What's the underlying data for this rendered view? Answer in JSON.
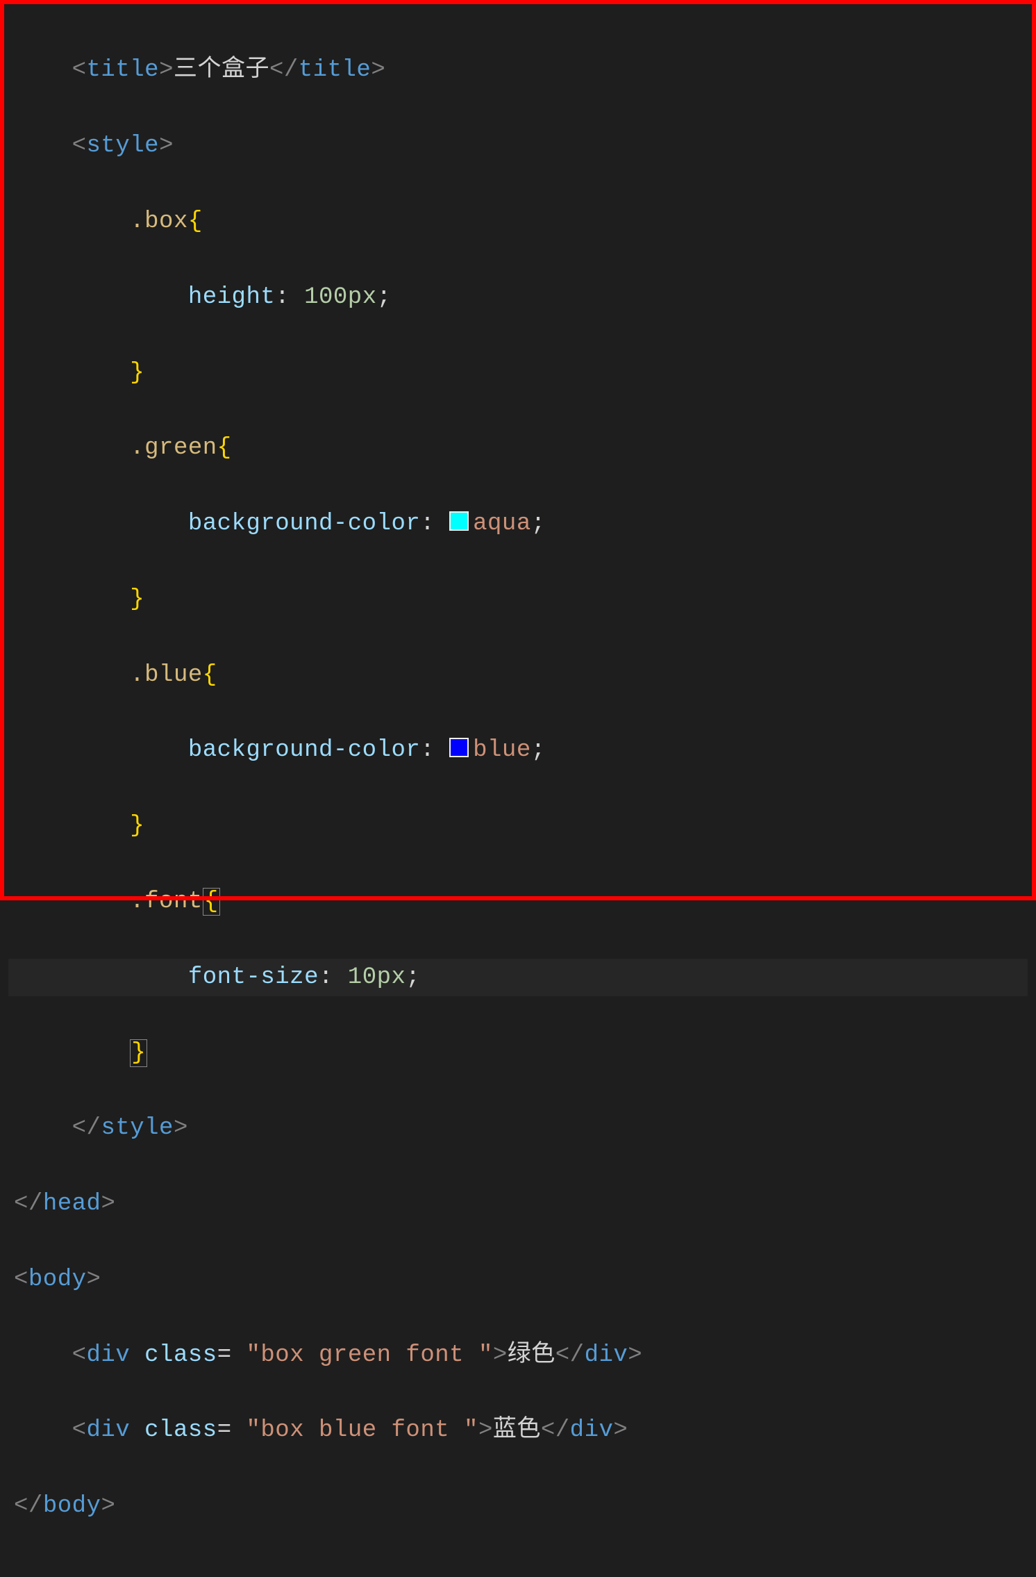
{
  "code": {
    "title_open_bracket1": "<",
    "title_tag": "title",
    "title_open_bracket2": ">",
    "title_text": "三个盒子",
    "title_close_bracket1": "</",
    "title_close_bracket2": ">",
    "style_open_bracket1": "<",
    "style_tag": "style",
    "style_open_bracket2": ">",
    "sel_box": ".box",
    "brace_open": "{",
    "brace_close": "}",
    "prop_height": "height",
    "colon": ":",
    "val_100px": "100px",
    "semicolon": ";",
    "sel_green": ".green",
    "prop_bg": "background-color",
    "val_aqua": "aqua",
    "sel_blue": ".blue",
    "val_blue": "blue",
    "sel_font": ".font",
    "prop_fontsize": "font-size",
    "val_10px": "10px",
    "style_close_bracket1": "</",
    "style_close_bracket2": ">",
    "head_close_bracket1": "</",
    "head_tag": "head",
    "head_close_bracket2": ">",
    "body_open_bracket1": "<",
    "body_tag": "body",
    "body_open_bracket2": ">",
    "div_open_bracket1": "<",
    "div_tag": "div",
    "space": " ",
    "attr_class": "class",
    "eq": "=",
    "val_class1": "\"box green font \"",
    "div_open_bracket2": ">",
    "div1_text": "绿色",
    "div_close_bracket1": "</",
    "div_close_bracket2": ">",
    "val_class2": "\"box blue font \"",
    "div2_text": "蓝色",
    "body_close_bracket1": "</",
    "body_close_bracket2": ">"
  }
}
